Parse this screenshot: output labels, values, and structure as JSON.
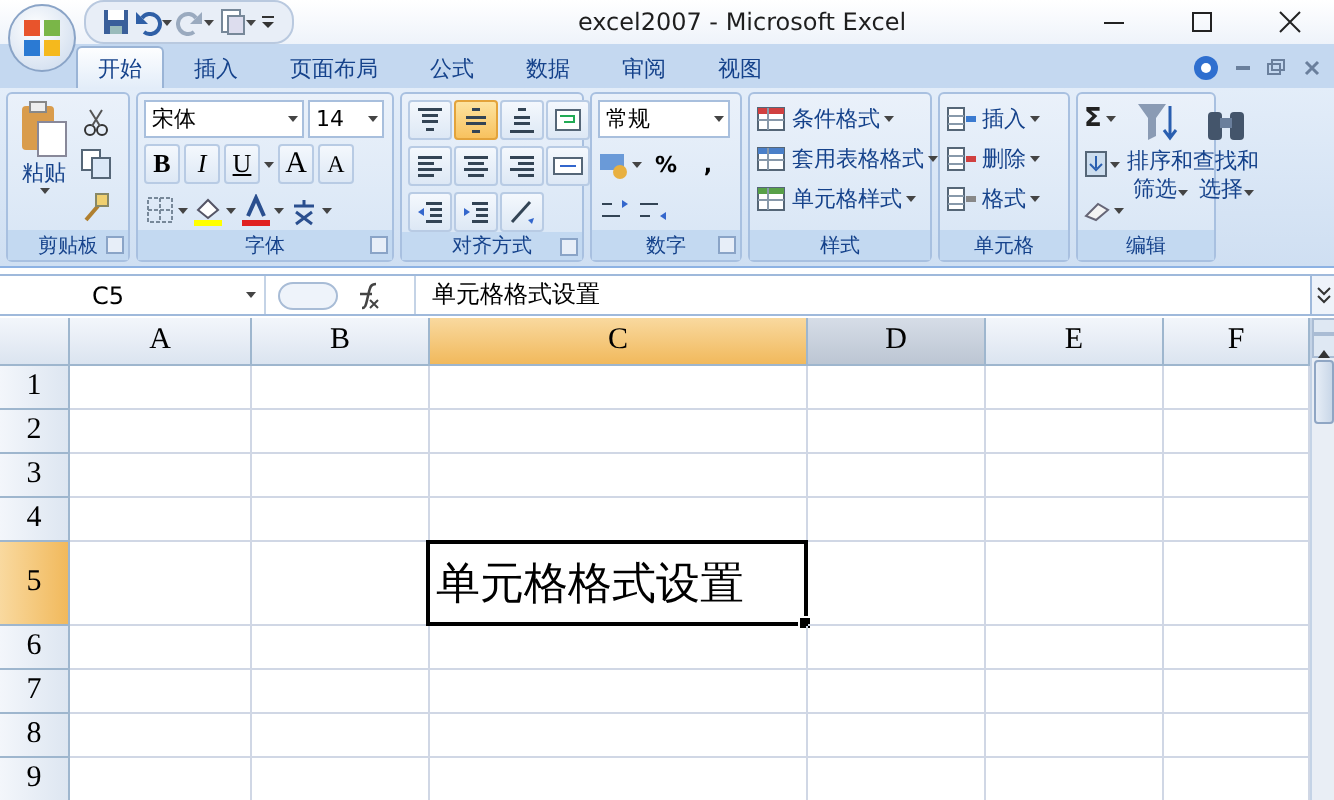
{
  "window": {
    "title": "excel2007 - Microsoft Excel"
  },
  "tabs": [
    {
      "label": "开始",
      "selected": true
    },
    {
      "label": "插入",
      "selected": false
    },
    {
      "label": "页面布局",
      "selected": false
    },
    {
      "label": "公式",
      "selected": false
    },
    {
      "label": "数据",
      "selected": false
    },
    {
      "label": "审阅",
      "selected": false
    },
    {
      "label": "视图",
      "selected": false
    }
  ],
  "ribbon": {
    "clipboard": {
      "name": "剪贴板",
      "paste": "粘贴"
    },
    "font": {
      "name": "字体",
      "font_name": "宋体",
      "font_size": "14",
      "styles": [
        "B",
        "I",
        "U"
      ],
      "size_buttons": [
        "A",
        "A"
      ]
    },
    "alignment": {
      "name": "对齐方式",
      "buttons": [
        {
          "selected": false
        },
        {
          "selected": true
        },
        {
          "selected": false
        },
        {
          "selected": false
        },
        {
          "selected": false
        },
        {
          "selected": false
        },
        {
          "selected": false
        },
        {
          "selected": false
        },
        {
          "selected": false
        },
        {
          "selected": false
        },
        {
          "selected": false
        }
      ]
    },
    "number": {
      "name": "数字",
      "format": "常规",
      "symbols": [
        "%",
        ","
      ]
    },
    "styles": {
      "name": "样式",
      "items": [
        "条件格式",
        "套用表格格式",
        "单元格样式"
      ]
    },
    "cells": {
      "name": "单元格",
      "items": [
        "插入",
        "删除",
        "格式"
      ]
    },
    "editing": {
      "name": "编辑",
      "sum": "Σ",
      "sort": "排序和筛选",
      "find": "查找和选择"
    }
  },
  "formula_bar": {
    "name_box": "C5",
    "formula": "单元格格式设置"
  },
  "sheet": {
    "columns": [
      {
        "label": "A",
        "selected": false,
        "hovered": false
      },
      {
        "label": "B",
        "selected": false,
        "hovered": false
      },
      {
        "label": "C",
        "selected": true,
        "hovered": false
      },
      {
        "label": "D",
        "selected": false,
        "hovered": true
      },
      {
        "label": "E",
        "selected": false,
        "hovered": false
      },
      {
        "label": "F",
        "selected": false,
        "hovered": false
      }
    ],
    "rows": [
      {
        "label": "1",
        "selected": false
      },
      {
        "label": "2",
        "selected": false
      },
      {
        "label": "3",
        "selected": false
      },
      {
        "label": "4",
        "selected": false
      },
      {
        "label": "5",
        "selected": true
      },
      {
        "label": "6",
        "selected": false
      },
      {
        "label": "7",
        "selected": false
      },
      {
        "label": "8",
        "selected": false
      },
      {
        "label": "9",
        "selected": false
      }
    ],
    "active_cell": {
      "value": "单元格格式设置"
    }
  }
}
